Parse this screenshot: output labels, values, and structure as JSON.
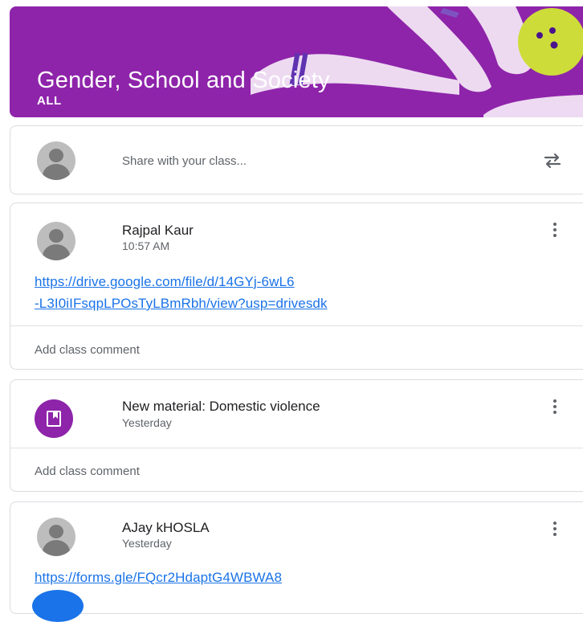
{
  "header": {
    "title": "Gender, School and Society",
    "subtitle": "ALL",
    "theme_color": "#8e24aa"
  },
  "share": {
    "placeholder": "Share with your class...",
    "avatar_icon": "person-icon",
    "repost_icon": "repost-icon"
  },
  "posts": [
    {
      "author": "Rajpal Kaur",
      "time": "10:57 AM",
      "link_line1": "https://drive.google.com/file/d/14GYj-6wL6",
      "link_line2": "-L3I0iIFsqpLPOsTyLBmRbh/view?usp=drivesdk",
      "comment": "Add class comment"
    },
    {
      "author": "New material: Domestic violence",
      "time": "Yesterday",
      "comment": "Add class comment",
      "icon": "material-icon"
    },
    {
      "author": "AJay kHOSLA",
      "time": "Yesterday",
      "link_line1": "https://forms.gle/FQcr2HdaptG4WBWA8"
    }
  ],
  "colors": {
    "link": "#1a73e8",
    "secondary_text": "#5f6368"
  }
}
